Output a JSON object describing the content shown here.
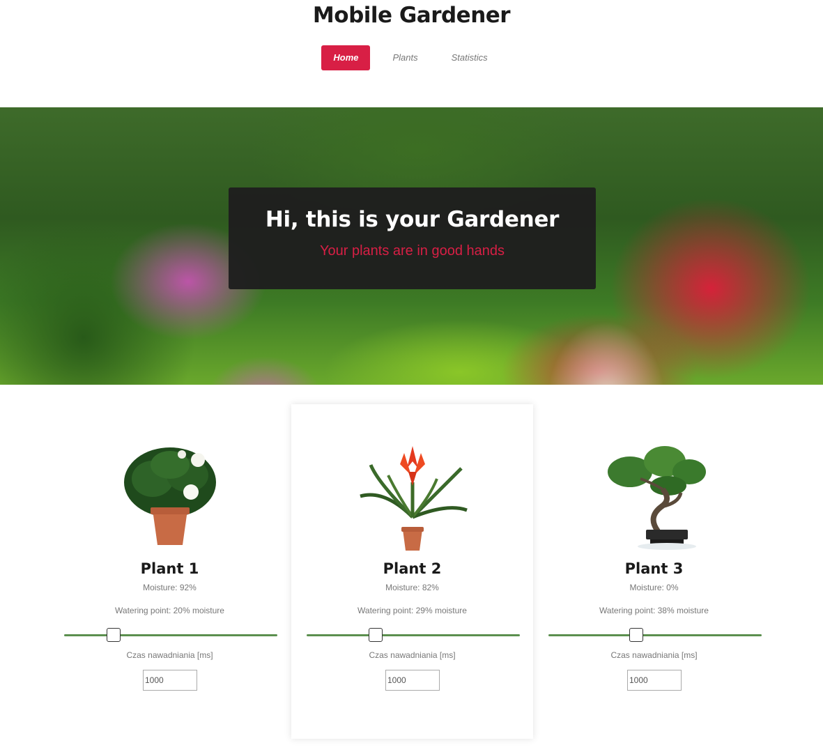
{
  "header": {
    "title": "Mobile Gardener",
    "nav": [
      {
        "label": "Home",
        "active": true
      },
      {
        "label": "Plants",
        "active": false
      },
      {
        "label": "Statistics",
        "active": false
      }
    ]
  },
  "hero": {
    "title": "Hi, this is your Gardener",
    "subtitle": "Your plants are in good hands"
  },
  "plants": [
    {
      "name": "Plant 1",
      "moisture": "Moisture: 92%",
      "watering": "Watering point: 20% moisture",
      "slider_value": 0.2,
      "czas_label": "Czas nawadniania [ms]",
      "czas_value": "1000"
    },
    {
      "name": "Plant 2",
      "moisture": "Moisture: 82%",
      "watering": "Watering point: 29% moisture",
      "slider_value": 0.29,
      "czas_label": "Czas nawadniania [ms]",
      "czas_value": "1000"
    },
    {
      "name": "Plant 3",
      "moisture": "Moisture: 0%",
      "watering": "Watering point: 38% moisture",
      "slider_value": 0.38,
      "czas_label": "Czas nawadniania [ms]",
      "czas_value": "1000"
    }
  ],
  "colors": {
    "accent": "#d81f45",
    "slider": "#5b8f4e",
    "hero_box": "#1e1e1e"
  }
}
